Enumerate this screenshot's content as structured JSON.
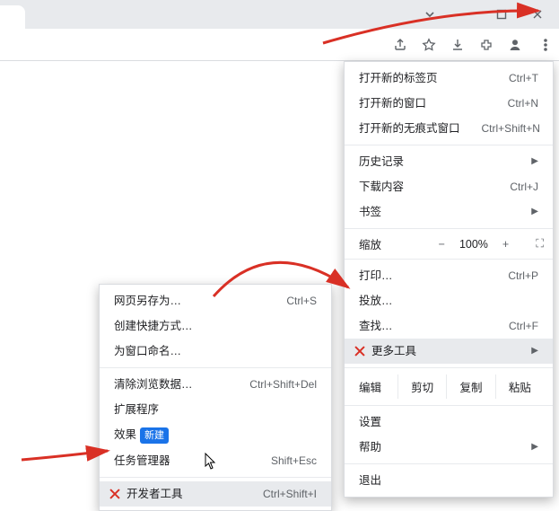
{
  "window": {
    "chevron_tip": "tab-dropdown",
    "minimize": "minimize",
    "maximize": "maximize",
    "close": "close"
  },
  "toolbar": {
    "share": "share",
    "star": "star",
    "download": "download",
    "extensions": "extensions",
    "profile": "profile",
    "menu": "menu"
  },
  "menu": {
    "new_tab": {
      "label": "打开新的标签页",
      "shortcut": "Ctrl+T"
    },
    "new_window": {
      "label": "打开新的窗口",
      "shortcut": "Ctrl+N"
    },
    "new_incognito": {
      "label": "打开新的无痕式窗口",
      "shortcut": "Ctrl+Shift+N"
    },
    "history": {
      "label": "历史记录"
    },
    "downloads": {
      "label": "下载内容",
      "shortcut": "Ctrl+J"
    },
    "bookmarks": {
      "label": "书签"
    },
    "zoom": {
      "label": "缩放",
      "minus": "−",
      "pct": "100%",
      "plus": "+",
      "fullscreen": "⛶"
    },
    "print": {
      "label": "打印…",
      "shortcut": "Ctrl+P"
    },
    "cast": {
      "label": "投放…"
    },
    "find": {
      "label": "查找…",
      "shortcut": "Ctrl+F"
    },
    "more_tools": {
      "label": "更多工具"
    },
    "edit": {
      "label": "编辑",
      "cut": "剪切",
      "copy": "复制",
      "paste": "粘贴"
    },
    "settings": {
      "label": "设置"
    },
    "help": {
      "label": "帮助"
    },
    "exit": {
      "label": "退出"
    }
  },
  "submenu": {
    "save_as": {
      "label": "网页另存为…",
      "shortcut": "Ctrl+S"
    },
    "create_shortcut": {
      "label": "创建快捷方式…"
    },
    "name_window": {
      "label": "为窗口命名…"
    },
    "clear_data": {
      "label": "清除浏览数据…",
      "shortcut": "Ctrl+Shift+Del"
    },
    "extensions": {
      "label": "扩展程序"
    },
    "effects": {
      "label": "效果",
      "badge": "新建"
    },
    "task_manager": {
      "label": "任务管理器",
      "shortcut": "Shift+Esc"
    },
    "devtools": {
      "label": "开发者工具",
      "shortcut": "Ctrl+Shift+I"
    }
  }
}
